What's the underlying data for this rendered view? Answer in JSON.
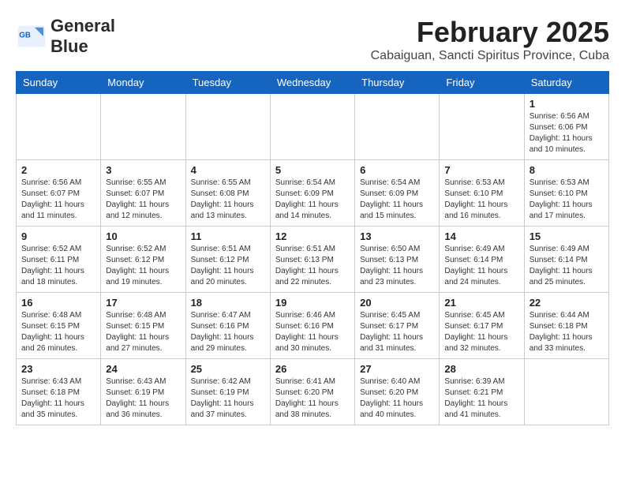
{
  "header": {
    "logo_general": "General",
    "logo_blue": "Blue",
    "month_title": "February 2025",
    "location": "Cabaiguan, Sancti Spiritus Province, Cuba"
  },
  "weekdays": [
    "Sunday",
    "Monday",
    "Tuesday",
    "Wednesday",
    "Thursday",
    "Friday",
    "Saturday"
  ],
  "weeks": [
    [
      {
        "day": "",
        "info": ""
      },
      {
        "day": "",
        "info": ""
      },
      {
        "day": "",
        "info": ""
      },
      {
        "day": "",
        "info": ""
      },
      {
        "day": "",
        "info": ""
      },
      {
        "day": "",
        "info": ""
      },
      {
        "day": "1",
        "info": "Sunrise: 6:56 AM\nSunset: 6:06 PM\nDaylight: 11 hours\nand 10 minutes."
      }
    ],
    [
      {
        "day": "2",
        "info": "Sunrise: 6:56 AM\nSunset: 6:07 PM\nDaylight: 11 hours\nand 11 minutes."
      },
      {
        "day": "3",
        "info": "Sunrise: 6:55 AM\nSunset: 6:07 PM\nDaylight: 11 hours\nand 12 minutes."
      },
      {
        "day": "4",
        "info": "Sunrise: 6:55 AM\nSunset: 6:08 PM\nDaylight: 11 hours\nand 13 minutes."
      },
      {
        "day": "5",
        "info": "Sunrise: 6:54 AM\nSunset: 6:09 PM\nDaylight: 11 hours\nand 14 minutes."
      },
      {
        "day": "6",
        "info": "Sunrise: 6:54 AM\nSunset: 6:09 PM\nDaylight: 11 hours\nand 15 minutes."
      },
      {
        "day": "7",
        "info": "Sunrise: 6:53 AM\nSunset: 6:10 PM\nDaylight: 11 hours\nand 16 minutes."
      },
      {
        "day": "8",
        "info": "Sunrise: 6:53 AM\nSunset: 6:10 PM\nDaylight: 11 hours\nand 17 minutes."
      }
    ],
    [
      {
        "day": "9",
        "info": "Sunrise: 6:52 AM\nSunset: 6:11 PM\nDaylight: 11 hours\nand 18 minutes."
      },
      {
        "day": "10",
        "info": "Sunrise: 6:52 AM\nSunset: 6:12 PM\nDaylight: 11 hours\nand 19 minutes."
      },
      {
        "day": "11",
        "info": "Sunrise: 6:51 AM\nSunset: 6:12 PM\nDaylight: 11 hours\nand 20 minutes."
      },
      {
        "day": "12",
        "info": "Sunrise: 6:51 AM\nSunset: 6:13 PM\nDaylight: 11 hours\nand 22 minutes."
      },
      {
        "day": "13",
        "info": "Sunrise: 6:50 AM\nSunset: 6:13 PM\nDaylight: 11 hours\nand 23 minutes."
      },
      {
        "day": "14",
        "info": "Sunrise: 6:49 AM\nSunset: 6:14 PM\nDaylight: 11 hours\nand 24 minutes."
      },
      {
        "day": "15",
        "info": "Sunrise: 6:49 AM\nSunset: 6:14 PM\nDaylight: 11 hours\nand 25 minutes."
      }
    ],
    [
      {
        "day": "16",
        "info": "Sunrise: 6:48 AM\nSunset: 6:15 PM\nDaylight: 11 hours\nand 26 minutes."
      },
      {
        "day": "17",
        "info": "Sunrise: 6:48 AM\nSunset: 6:15 PM\nDaylight: 11 hours\nand 27 minutes."
      },
      {
        "day": "18",
        "info": "Sunrise: 6:47 AM\nSunset: 6:16 PM\nDaylight: 11 hours\nand 29 minutes."
      },
      {
        "day": "19",
        "info": "Sunrise: 6:46 AM\nSunset: 6:16 PM\nDaylight: 11 hours\nand 30 minutes."
      },
      {
        "day": "20",
        "info": "Sunrise: 6:45 AM\nSunset: 6:17 PM\nDaylight: 11 hours\nand 31 minutes."
      },
      {
        "day": "21",
        "info": "Sunrise: 6:45 AM\nSunset: 6:17 PM\nDaylight: 11 hours\nand 32 minutes."
      },
      {
        "day": "22",
        "info": "Sunrise: 6:44 AM\nSunset: 6:18 PM\nDaylight: 11 hours\nand 33 minutes."
      }
    ],
    [
      {
        "day": "23",
        "info": "Sunrise: 6:43 AM\nSunset: 6:18 PM\nDaylight: 11 hours\nand 35 minutes."
      },
      {
        "day": "24",
        "info": "Sunrise: 6:43 AM\nSunset: 6:19 PM\nDaylight: 11 hours\nand 36 minutes."
      },
      {
        "day": "25",
        "info": "Sunrise: 6:42 AM\nSunset: 6:19 PM\nDaylight: 11 hours\nand 37 minutes."
      },
      {
        "day": "26",
        "info": "Sunrise: 6:41 AM\nSunset: 6:20 PM\nDaylight: 11 hours\nand 38 minutes."
      },
      {
        "day": "27",
        "info": "Sunrise: 6:40 AM\nSunset: 6:20 PM\nDaylight: 11 hours\nand 40 minutes."
      },
      {
        "day": "28",
        "info": "Sunrise: 6:39 AM\nSunset: 6:21 PM\nDaylight: 11 hours\nand 41 minutes."
      },
      {
        "day": "",
        "info": ""
      }
    ]
  ]
}
